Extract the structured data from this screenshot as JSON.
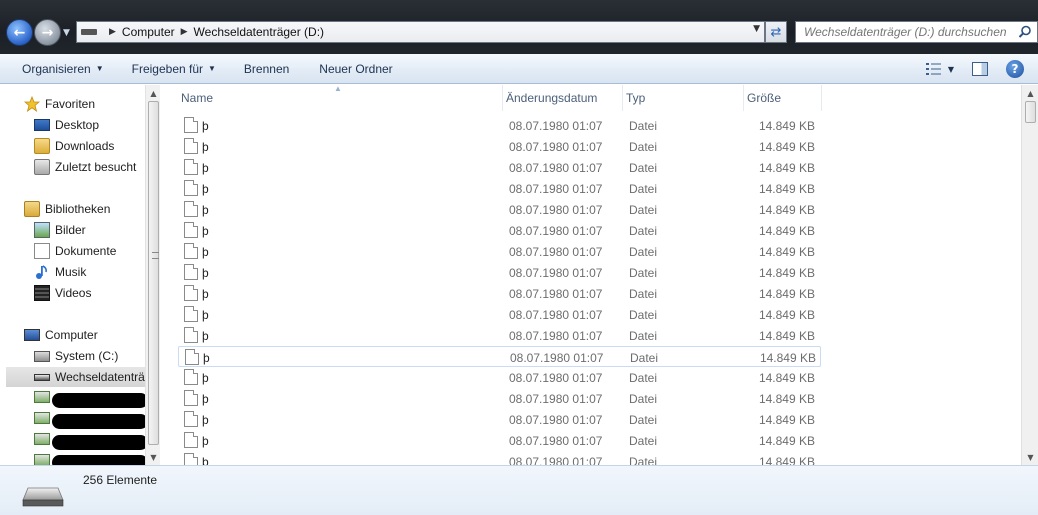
{
  "address": {
    "crumbs": [
      "Computer",
      "Wechseldatenträger (D:)"
    ]
  },
  "search": {
    "placeholder": "Wechseldatenträger (D:) durchsuchen"
  },
  "toolbar": {
    "organize": "Organisieren",
    "share": "Freigeben für",
    "burn": "Brennen",
    "new_folder": "Neuer Ordner"
  },
  "nav": {
    "favorites": "Favoriten",
    "desktop": "Desktop",
    "downloads": "Downloads",
    "recent": "Zuletzt besucht",
    "libraries": "Bibliotheken",
    "pictures": "Bilder",
    "documents": "Dokumente",
    "music": "Musik",
    "videos": "Videos",
    "computer": "Computer",
    "system": "System (C:)",
    "removable": "Wechseldatenträ"
  },
  "columns": {
    "name": "Name",
    "date": "Änderungsdatum",
    "type": "Typ",
    "size": "Größe"
  },
  "files": [
    {
      "name": "þ",
      "date": "08.07.1980 01:07",
      "type": "Datei",
      "size": "14.849 KB"
    },
    {
      "name": "þ",
      "date": "08.07.1980 01:07",
      "type": "Datei",
      "size": "14.849 KB"
    },
    {
      "name": "þ",
      "date": "08.07.1980 01:07",
      "type": "Datei",
      "size": "14.849 KB"
    },
    {
      "name": "þ",
      "date": "08.07.1980 01:07",
      "type": "Datei",
      "size": "14.849 KB"
    },
    {
      "name": "þ",
      "date": "08.07.1980 01:07",
      "type": "Datei",
      "size": "14.849 KB"
    },
    {
      "name": "þ",
      "date": "08.07.1980 01:07",
      "type": "Datei",
      "size": "14.849 KB"
    },
    {
      "name": "þ",
      "date": "08.07.1980 01:07",
      "type": "Datei",
      "size": "14.849 KB"
    },
    {
      "name": "þ",
      "date": "08.07.1980 01:07",
      "type": "Datei",
      "size": "14.849 KB"
    },
    {
      "name": "þ",
      "date": "08.07.1980 01:07",
      "type": "Datei",
      "size": "14.849 KB"
    },
    {
      "name": "þ",
      "date": "08.07.1980 01:07",
      "type": "Datei",
      "size": "14.849 KB"
    },
    {
      "name": "þ",
      "date": "08.07.1980 01:07",
      "type": "Datei",
      "size": "14.849 KB"
    },
    {
      "name": "þ",
      "date": "08.07.1980 01:07",
      "type": "Datei",
      "size": "14.849 KB"
    },
    {
      "name": "þ",
      "date": "08.07.1980 01:07",
      "type": "Datei",
      "size": "14.849 KB"
    },
    {
      "name": "þ",
      "date": "08.07.1980 01:07",
      "type": "Datei",
      "size": "14.849 KB"
    },
    {
      "name": "þ",
      "date": "08.07.1980 01:07",
      "type": "Datei",
      "size": "14.849 KB"
    },
    {
      "name": "þ",
      "date": "08.07.1980 01:07",
      "type": "Datei",
      "size": "14.849 KB"
    },
    {
      "name": "þ",
      "date": "08.07.1980 01:07",
      "type": "Datei",
      "size": "14.849 KB"
    }
  ],
  "selected_row": 11,
  "status": {
    "count": "256 Elemente"
  },
  "colors": {
    "toolbar_text": "#1e3251",
    "header_text": "#4c607a",
    "detail_text": "#6d6d6d",
    "selection_border": "#c9dcf1"
  }
}
